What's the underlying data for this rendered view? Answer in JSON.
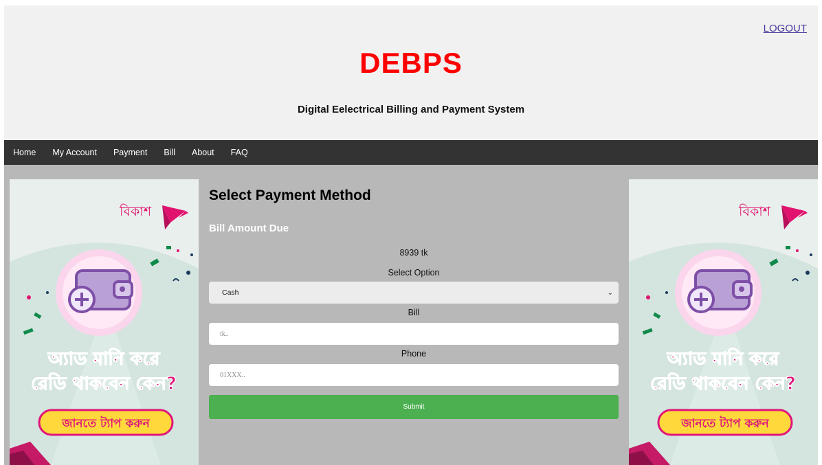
{
  "header": {
    "logout_label": "LOGOUT",
    "site_title": "DEBPS",
    "site_subtitle": "Digital Eelectrical Billing and Payment System"
  },
  "nav": {
    "items": [
      "Home",
      "My Account",
      "Payment",
      "Bill",
      "About",
      "FAQ"
    ]
  },
  "payment": {
    "title": "Select Payment Method",
    "amount_heading": "Bill Amount Due",
    "amount_value": "8939 tk",
    "option_label": "Select Option",
    "option_selected": "Cash",
    "bill_label": "Bill",
    "bill_placeholder": "tk..",
    "phone_label": "Phone",
    "phone_placeholder": "01XXX..",
    "submit_label": "Submit"
  },
  "ads": {
    "brand": "বিকাশ",
    "line1": "অ্যাড মানি করে",
    "line2": "রেডি থাকবেন কেন?",
    "cta": "জানতে ট্যাপ করুন"
  },
  "colors": {
    "title_red": "#ff0000",
    "nav_bg": "#333333",
    "submit_green": "#4caf50",
    "bkash_pink": "#e2136e",
    "ad_headline_pink": "#e0157a",
    "cta_yellow": "#ffd93b"
  }
}
